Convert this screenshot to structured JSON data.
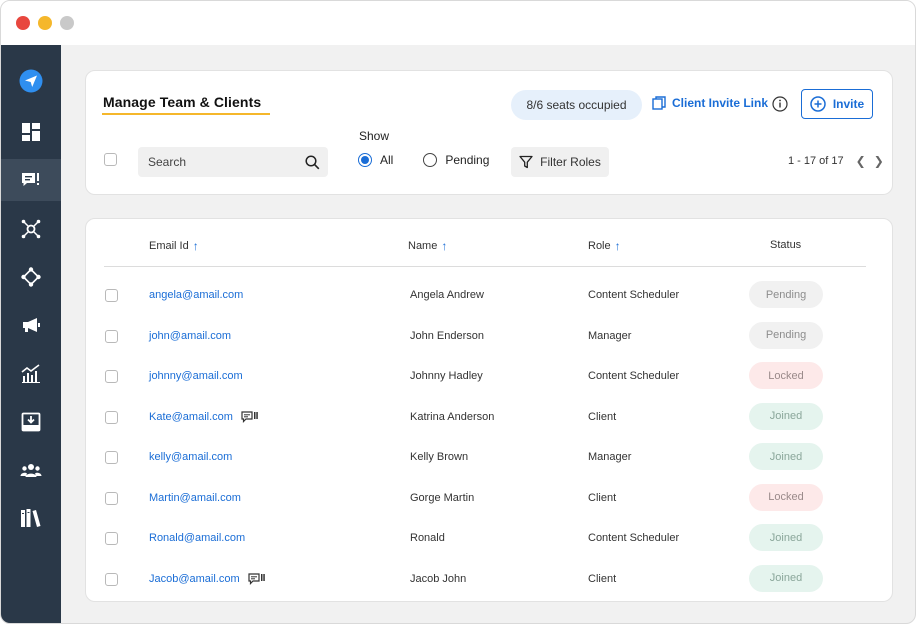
{
  "header": {
    "title": "Manage Team & Clients",
    "seats": "8/6 seats occupied",
    "invite_link": "Client Invite Link",
    "invite_button": "Invite",
    "accent": "#1a6dd6",
    "underline_color": "#f5b72b"
  },
  "sidebar": {
    "items": [
      {
        "icon": "send-icon",
        "active": false
      },
      {
        "icon": "dashboard-icon",
        "active": false
      },
      {
        "icon": "team-chat-icon",
        "active": true
      },
      {
        "icon": "network-icon",
        "active": false
      },
      {
        "icon": "move-icon",
        "active": false
      },
      {
        "icon": "megaphone-icon",
        "active": false
      },
      {
        "icon": "analytics-icon",
        "active": false
      },
      {
        "icon": "inbox-download-icon",
        "active": false
      },
      {
        "icon": "users-icon",
        "active": false
      },
      {
        "icon": "library-icon",
        "active": false
      }
    ]
  },
  "filters": {
    "search_placeholder": "Search",
    "show_label": "Show",
    "options": [
      "All",
      "Pending"
    ],
    "selected": "All",
    "filter_roles": "Filter Roles",
    "pagination": "1 - 17 of 17"
  },
  "table": {
    "columns": [
      "Email Id",
      "Name",
      "Role",
      "Status"
    ],
    "rows": [
      {
        "email": "angela@amail.com",
        "name": "Angela Andrew",
        "role": "Content Scheduler",
        "status": "Pending",
        "chat_icon": false
      },
      {
        "email": "john@amail.com",
        "name": "John Enderson",
        "role": "Manager",
        "status": "Pending",
        "chat_icon": false
      },
      {
        "email": "johnny@amail.com",
        "name": "Johnny Hadley",
        "role": "Content Scheduler",
        "status": "Locked",
        "chat_icon": false
      },
      {
        "email": "Kate@amail.com",
        "name": "Katrina Anderson",
        "role": "Client",
        "status": "Joined",
        "chat_icon": true
      },
      {
        "email": "kelly@amail.com",
        "name": "Kelly Brown",
        "role": "Manager",
        "status": "Joined",
        "chat_icon": false
      },
      {
        "email": "Martin@amail.com",
        "name": "Gorge Martin",
        "role": "Client",
        "status": "Locked",
        "chat_icon": false
      },
      {
        "email": "Ronald@amail.com",
        "name": "Ronald",
        "role": "Content Scheduler",
        "status": "Joined",
        "chat_icon": false
      },
      {
        "email": "Jacob@amail.com",
        "name": "Jacob John",
        "role": "Client",
        "status": "Joined",
        "chat_icon": true
      }
    ]
  }
}
